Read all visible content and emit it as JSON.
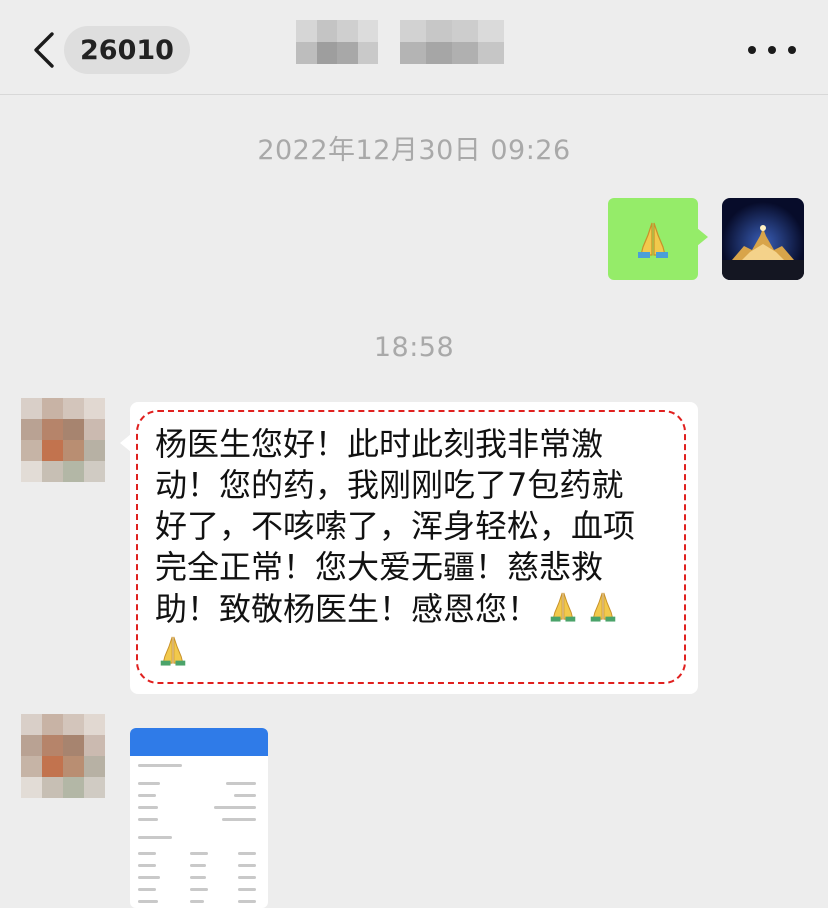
{
  "nav": {
    "chat_count": "26010"
  },
  "chat": {
    "timestamp_1": "2022年12月30日 09:26",
    "sent_emoji": "praying-hands",
    "timestamp_2": "18:58",
    "message_lines": [
      "杨医生您好！此时此刻我非常激",
      "动！您的药，我刚刚吃了7包药就",
      "好了，不咳嗦了，浑身轻松，血项",
      "完全正常！您大爱无疆！慈悲救",
      "助！致敬杨医生！感恩您！"
    ]
  },
  "colors": {
    "background": "#ededed",
    "sent_bubble": "#95ec69",
    "received_bubble": "#ffffff",
    "highlight_dash": "#e0201f",
    "timestamp": "#a9a9a9"
  }
}
